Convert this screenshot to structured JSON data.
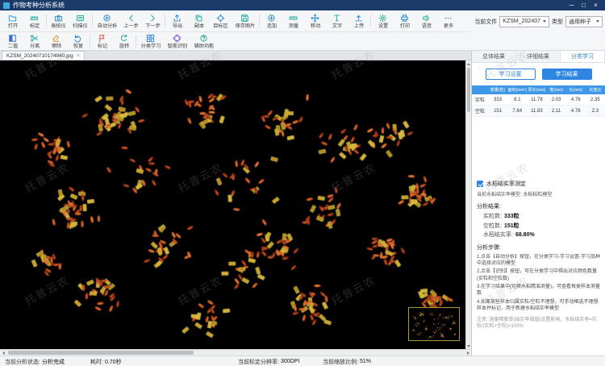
{
  "window": {
    "title": "作物考种分析系统",
    "minimize": "─",
    "maximize": "□",
    "close": "×"
  },
  "toolbar_main": {
    "items": [
      {
        "label": "打开",
        "icon": "open",
        "color": "#2b9fd8"
      },
      {
        "label": "标定",
        "icon": "calibrate",
        "color": "#27a8a0"
      },
      {
        "label": "高拍仪",
        "icon": "camera",
        "color": "#2b86d4"
      },
      {
        "label": "扫描仪",
        "icon": "scanner",
        "color": "#27a8a0"
      },
      {
        "label": "自动分析",
        "icon": "auto",
        "color": "#2b86d4"
      },
      {
        "label": "上一步",
        "icon": "prev",
        "color": "#27a8a0"
      },
      {
        "label": "下一步",
        "icon": "next",
        "color": "#27a8a0"
      },
      {
        "label": "导出",
        "icon": "export",
        "color": "#2b86d4"
      },
      {
        "label": "副本",
        "icon": "copy",
        "color": "#27a8a0"
      },
      {
        "label": "目标区",
        "icon": "target",
        "color": "#2b86d4"
      },
      {
        "label": "保存图片",
        "icon": "save",
        "color": "#27a8a0"
      },
      {
        "label": "追加",
        "icon": "append",
        "color": "#2b86d4"
      },
      {
        "label": "测量",
        "icon": "measure",
        "color": "#27a8a0"
      },
      {
        "label": "移动",
        "icon": "move",
        "color": "#2b86d4"
      },
      {
        "label": "文字",
        "icon": "text",
        "color": "#27a8a0"
      },
      {
        "label": "上传",
        "icon": "upload",
        "color": "#2b86d4"
      },
      {
        "label": "设置",
        "icon": "settings",
        "color": "#27a8a0"
      },
      {
        "label": "打印",
        "icon": "print",
        "color": "#2b86d4"
      },
      {
        "label": "语音",
        "icon": "voice",
        "color": "#27a8a0"
      },
      {
        "label": "更多",
        "icon": "more",
        "color": "#2b86d4"
      }
    ],
    "current_file_label": "当前文件",
    "current_file_value": "KZSM_202407",
    "type_label": "类型",
    "type_value": "通用种子"
  },
  "toolbar_edit": {
    "items": [
      {
        "label": "二值",
        "icon": "binary",
        "color": "#3b6fd4"
      },
      {
        "label": "分离",
        "icon": "split",
        "color": "#27a8a0"
      },
      {
        "label": "擦除",
        "icon": "erase",
        "color": "#d4902b"
      },
      {
        "label": "恢复",
        "icon": "undo",
        "color": "#2b86d4"
      },
      {
        "label": "标记",
        "icon": "mark",
        "color": "#d45050"
      },
      {
        "label": "旋转",
        "icon": "rotate",
        "color": "#27a8a0"
      },
      {
        "label": "分类学习",
        "icon": "learn",
        "color": "#2b86d4"
      },
      {
        "label": "智能识别",
        "icon": "ai",
        "color": "#8a5cd4"
      },
      {
        "label": "辅助功能",
        "icon": "assist",
        "color": "#27a8a0"
      }
    ]
  },
  "document_tab": {
    "filename": "KZSM_20240710174940.jpg",
    "close": "×"
  },
  "results_panel": {
    "tabs": [
      {
        "label": "总体结果",
        "active": false
      },
      {
        "label": "详细结果",
        "active": false
      },
      {
        "label": "分类学习",
        "active": true
      }
    ],
    "sub_tabs": [
      {
        "label": "学习设置",
        "active": false
      },
      {
        "label": "学习结果",
        "active": true
      }
    ],
    "table": {
      "headers": [
        "",
        "数量(粒)",
        "面积(mm²)",
        "周长(mm)",
        "宽(mm)",
        "长(mm)",
        "长宽比"
      ],
      "rows": [
        [
          "实粒",
          "333",
          "8.1",
          "11.78",
          "2.03",
          "4.76",
          "2.35"
        ],
        [
          "空粒",
          "151",
          "7.84",
          "11.83",
          "2.11",
          "4.76",
          "2.3"
        ]
      ]
    },
    "checkbox_label": "水稻结实率测定",
    "checkbox_checked": true,
    "model_line": "当前水稻结实率模型: 水稻稻粒模型",
    "result_title": "分析结果:",
    "results": [
      {
        "label": "实粒数:",
        "value": "333粒"
      },
      {
        "label": "空粒数:",
        "value": "151粒"
      },
      {
        "label": "水稻结实率:",
        "value": "68.80%"
      }
    ],
    "steps_title": "分析步骤:",
    "steps": [
      "1.点击【自动分析】按钮，在分类学习-学习设置-学习品种中选择对应的模型",
      "2.点击【识别】按钮，可在分类学习中得出对应颜色数量(实粒和空粒数)",
      "3.在学习结果中(切换水稻精准测量)，可查看每类样本测量数",
      "4.如果某些样本归属实粒/空粒不理想，可手动框选不理想样本并标记，用于新建水稻结实率模型"
    ],
    "note": "注意: 测量精度受(结实率阈值)设置影响，水稻结实率=实粒/(实粒+空粒)×100%"
  },
  "statusbar": {
    "items": [
      {
        "label": "当前分析状态:",
        "value": "分析完成"
      },
      {
        "label": "耗时:",
        "value": "0.70秒"
      },
      {
        "label": "当前标定分辨率:",
        "value": "300DPI"
      },
      {
        "label": "当前缩放比例:",
        "value": "51%"
      }
    ]
  },
  "watermark": {
    "text": "托普云农"
  },
  "image_view": {
    "grain_total": 333,
    "empty_total": 151,
    "fill_colors": [
      "#b5411a",
      "#c9561f",
      "#a83512",
      "#d4682a",
      "#93300f"
    ],
    "empty_colors": [
      "#c9a227",
      "#d6b236",
      "#b38d1d"
    ],
    "highlight_stroke": "#ead75c",
    "background": "#000000"
  }
}
